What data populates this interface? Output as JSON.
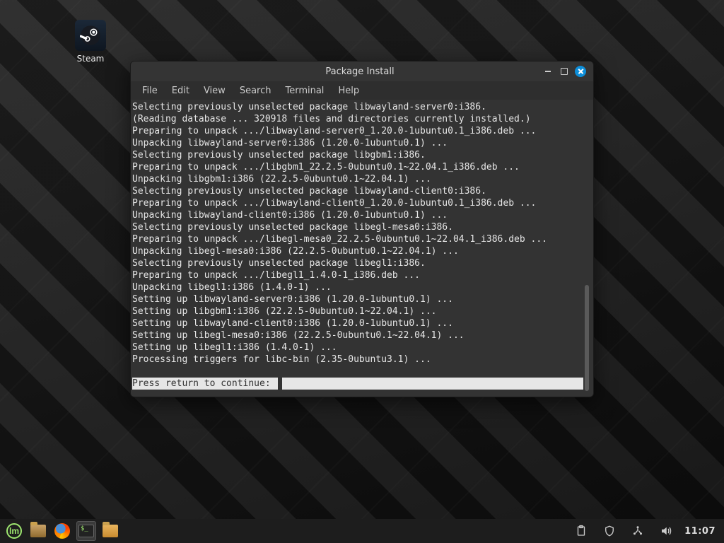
{
  "desktop": {
    "icons": [
      {
        "name": "steam",
        "label": "Steam"
      }
    ]
  },
  "window": {
    "title": "Package Install",
    "menu": [
      "File",
      "Edit",
      "View",
      "Search",
      "Terminal",
      "Help"
    ],
    "lines": [
      "Selecting previously unselected package libwayland-server0:i386.",
      "(Reading database ... 320918 files and directories currently installed.)",
      "Preparing to unpack .../libwayland-server0_1.20.0-1ubuntu0.1_i386.deb ...",
      "Unpacking libwayland-server0:i386 (1.20.0-1ubuntu0.1) ...",
      "Selecting previously unselected package libgbm1:i386.",
      "Preparing to unpack .../libgbm1_22.2.5-0ubuntu0.1~22.04.1_i386.deb ...",
      "Unpacking libgbm1:i386 (22.2.5-0ubuntu0.1~22.04.1) ...",
      "Selecting previously unselected package libwayland-client0:i386.",
      "Preparing to unpack .../libwayland-client0_1.20.0-1ubuntu0.1_i386.deb ...",
      "Unpacking libwayland-client0:i386 (1.20.0-1ubuntu0.1) ...",
      "Selecting previously unselected package libegl-mesa0:i386.",
      "Preparing to unpack .../libegl-mesa0_22.2.5-0ubuntu0.1~22.04.1_i386.deb ...",
      "Unpacking libegl-mesa0:i386 (22.2.5-0ubuntu0.1~22.04.1) ...",
      "Selecting previously unselected package libegl1:i386.",
      "Preparing to unpack .../libegl1_1.4.0-1_i386.deb ...",
      "Unpacking libegl1:i386 (1.4.0-1) ...",
      "Setting up libwayland-server0:i386 (1.20.0-1ubuntu0.1) ...",
      "Setting up libgbm1:i386 (22.2.5-0ubuntu0.1~22.04.1) ...",
      "Setting up libwayland-client0:i386 (1.20.0-1ubuntu0.1) ...",
      "Setting up libegl-mesa0:i386 (22.2.5-0ubuntu0.1~22.04.1) ...",
      "Setting up libegl1:i386 (1.4.0-1) ...",
      "Processing triggers for libc-bin (2.35-0ubuntu3.1) ..."
    ],
    "prompt": "Press return to continue: "
  },
  "taskbar": {
    "clock": "11:07"
  }
}
